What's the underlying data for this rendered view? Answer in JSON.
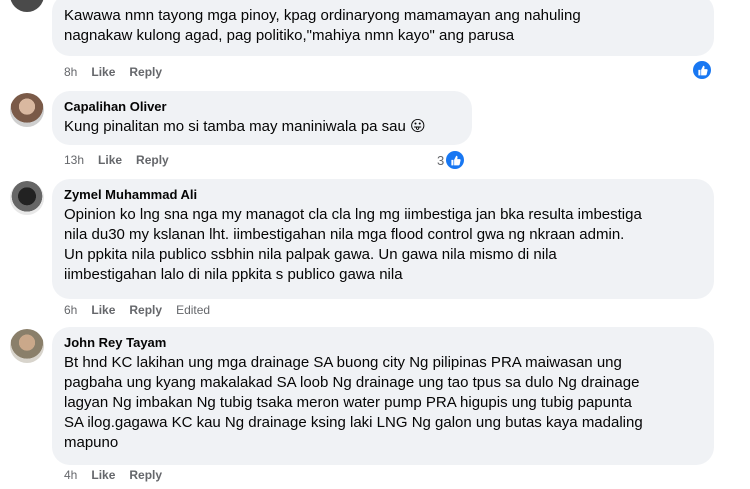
{
  "comments": [
    {
      "author": "",
      "text": "Kawawa nmn tayong mga pinoy, kpag ordinaryong mamamayan ang nahuling\nnagnakaw kulong agad, pag politiko,\"mahiya nmn kayo\" ang parusa",
      "time": "8h",
      "like": "Like",
      "reply": "Reply",
      "reaction_count": ""
    },
    {
      "author": "Capalihan Oliver",
      "text": "Kung pinalitan mo si tamba may maniniwala pa sau 😛",
      "time": "13h",
      "like": "Like",
      "reply": "Reply",
      "reaction_count": "3"
    },
    {
      "author": "Zymel Muhammad Ali",
      "text": "Opinion ko lng sna nga my managot cla cla lng mg iimbestiga jan bka resulta imbestiga\nnila du30 my kslanan lht. iimbestigahan nila mga flood control gwa ng nkraan admin.\nUn ppkita nila publico ssbhin nila palpak gawa. Un gawa nila mismo di nila\niimbestigahan lalo di nila ppkita s publico gawa nila",
      "time": "6h",
      "like": "Like",
      "reply": "Reply",
      "edited": "Edited"
    },
    {
      "author": "John Rey Tayam",
      "text": "Bt hnd KC lakihan ung mga drainage SA buong city Ng pilipinas PRA maiwasan ung\npagbaha ung kyang makalakad SA loob Ng drainage ung tao tpus sa dulo Ng drainage\nlagyan Ng imbakan Ng tubig tsaka meron water pump PRA higupis ung tubig papunta\nSA ilog.gagawa KC kau Ng drainage ksing laki LNG Ng galon ung butas kaya madaling\nmapuno",
      "time": "4h",
      "like": "Like",
      "reply": "Reply"
    }
  ],
  "colors": {
    "bubble": "#f0f2f5",
    "meta": "#65676b",
    "like_blue": "#1877f2"
  }
}
